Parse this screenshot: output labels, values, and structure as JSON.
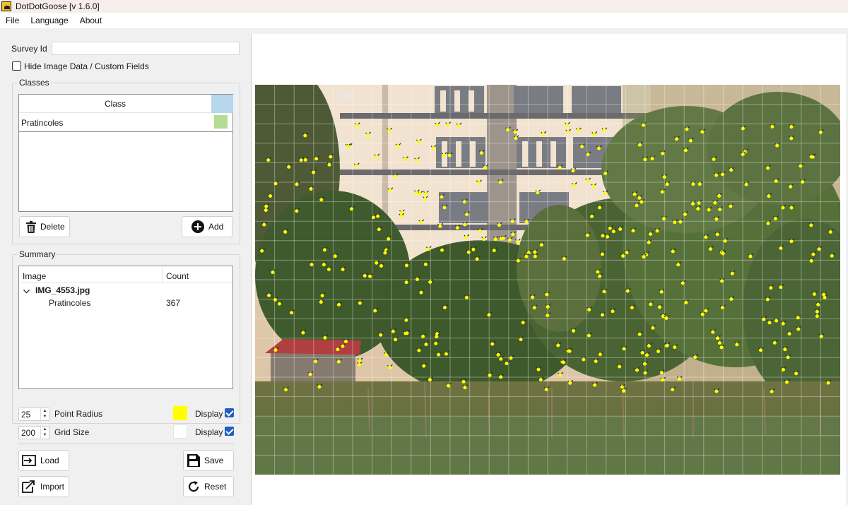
{
  "window": {
    "title": "DotDotGoose [v 1.6.0]"
  },
  "menu": {
    "items": [
      "File",
      "Language",
      "About"
    ]
  },
  "survey": {
    "label": "Survey Id",
    "value": ""
  },
  "hide_fields": {
    "label": "Hide Image Data / Custom Fields",
    "checked": false
  },
  "classes": {
    "title": "Classes",
    "header": "Class",
    "rows": [
      {
        "name": "Pratincoles",
        "color": "#b5dc94"
      }
    ],
    "header_color": "#b7d7ef",
    "delete_label": "Delete",
    "add_label": "Add"
  },
  "summary": {
    "title": "Summary",
    "columns": [
      "Image",
      "Count"
    ],
    "image": "IMG_4553.jpg",
    "rows": [
      {
        "class": "Pratincoles",
        "count": "367"
      }
    ]
  },
  "settings": {
    "point_radius": {
      "value": "25",
      "label": "Point Radius",
      "color": "#ffff00",
      "display_label": "Display",
      "display": true
    },
    "grid_size": {
      "value": "200",
      "label": "Grid Size",
      "color": "#ffffff",
      "display_label": "Display",
      "display": true
    }
  },
  "actions": {
    "load": "Load",
    "save": "Save",
    "import": "Import",
    "reset": "Reset"
  },
  "viewer": {
    "point_color": "#ffff00",
    "point_count": 367
  }
}
